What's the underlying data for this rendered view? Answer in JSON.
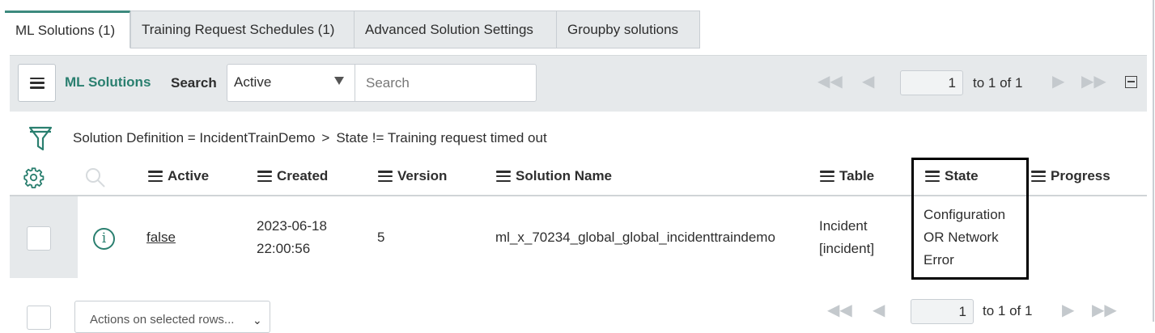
{
  "tabs": [
    {
      "label": "ML Solutions (1)",
      "active": true
    },
    {
      "label": "Training Request Schedules (1)",
      "active": false
    },
    {
      "label": "Advanced Solution Settings",
      "active": false
    },
    {
      "label": "Groupby solutions",
      "active": false
    }
  ],
  "toolbar": {
    "list_title": "ML Solutions",
    "search_label": "Search",
    "filter_select": "Active",
    "search_placeholder": "Search"
  },
  "pagination": {
    "page": "1",
    "range_text": "to 1 of 1"
  },
  "breadcrumb": {
    "part1": "Solution Definition = IncidentTrainDemo",
    "separator": ">",
    "part2": "State != Training request timed out"
  },
  "columns": {
    "active": "Active",
    "created": "Created",
    "version": "Version",
    "solution_name": "Solution Name",
    "table": "Table",
    "state": "State",
    "progress": "Progress"
  },
  "row": {
    "active": "false",
    "created_date": "2023-06-18",
    "created_time": "22:00:56",
    "version": "5",
    "solution_name": "ml_x_70234_global_global_incidenttraindemo",
    "table_line1": "Incident",
    "table_line2": "[incident]",
    "state_line1": "Configuration",
    "state_line2": "OR Network",
    "state_line3": "Error",
    "progress": ""
  },
  "footer": {
    "actions_label": "Actions on selected rows...",
    "page": "1",
    "range_text": "to 1 of 1"
  },
  "colors": {
    "accent": "#2a7f6f",
    "toolbar_bg": "#e6e9eb",
    "highlight_border": "#000000"
  },
  "icons": [
    "hamburger-icon",
    "dropdown-arrow-icon",
    "first-page-icon",
    "prev-page-icon",
    "next-page-icon",
    "last-page-icon",
    "collapse-icon",
    "filter-funnel-icon",
    "gear-icon",
    "search-icon",
    "info-icon",
    "chevron-down-icon"
  ]
}
